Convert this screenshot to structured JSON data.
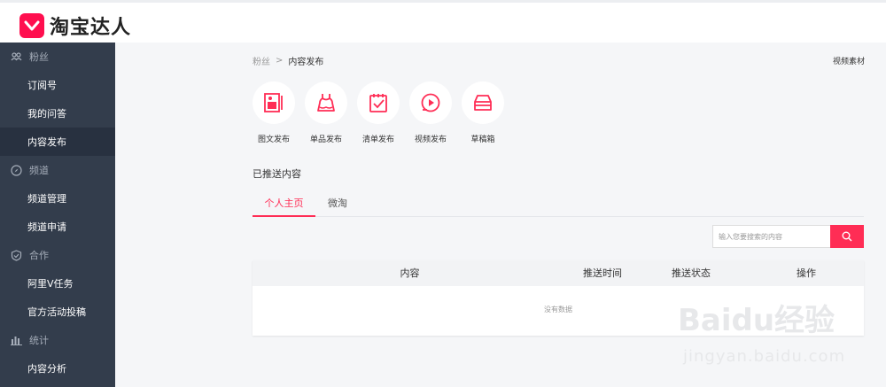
{
  "brand": {
    "name": "淘宝达人",
    "accent": "#ff2d55"
  },
  "sidebar": {
    "groups": [
      {
        "label": "粉丝",
        "icon": "fans-icon",
        "items": [
          "订阅号",
          "我的问答",
          "内容发布"
        ]
      },
      {
        "label": "频道",
        "icon": "compass-icon",
        "items": [
          "频道管理",
          "频道申请"
        ]
      },
      {
        "label": "合作",
        "icon": "shield-check-icon",
        "items": [
          "阿里V任务",
          "官方活动投稿"
        ]
      },
      {
        "label": "统计",
        "icon": "bar-chart-icon",
        "items": [
          "内容分析"
        ]
      }
    ],
    "active": "内容发布"
  },
  "breadcrumb": {
    "parent": "粉丝",
    "separator": ">",
    "current": "内容发布"
  },
  "video_material_link": "视频素材",
  "publish_options": [
    {
      "label": "图文发布",
      "icon": "image-text-icon"
    },
    {
      "label": "单品发布",
      "icon": "dress-icon"
    },
    {
      "label": "清单发布",
      "icon": "checklist-icon"
    },
    {
      "label": "视频发布",
      "icon": "play-icon"
    },
    {
      "label": "草稿箱",
      "icon": "inbox-icon"
    }
  ],
  "section_title": "已推送内容",
  "tabs": [
    "个人主页",
    "微淘"
  ],
  "search": {
    "placeholder": "输入您要搜索的内容"
  },
  "table": {
    "columns": [
      "内容",
      "推送时间",
      "推送状态",
      "操作"
    ],
    "empty_text": "没有数据"
  },
  "watermark": {
    "main": "Baidu经验",
    "sub": "jingyan.baidu.com"
  }
}
